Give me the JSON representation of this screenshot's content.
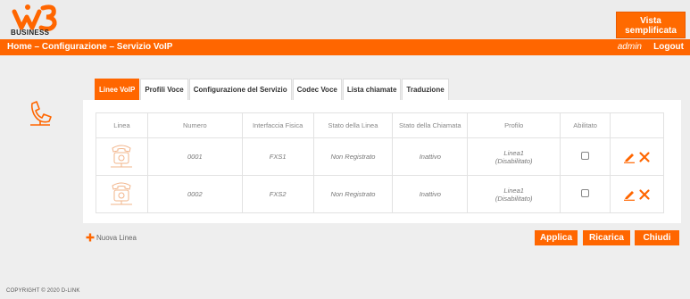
{
  "brand": {
    "logo_text": "BUSINESS",
    "accent_color": "#ff6600",
    "simple_view_label": "Vista semplificata"
  },
  "nav": {
    "breadcrumb": "Home – Configurazione – Servizio VoIP",
    "user": "admin",
    "logout_label": "Logout"
  },
  "tabs": [
    {
      "label": "Linee VoIP",
      "active": true
    },
    {
      "label": "Profili Voce",
      "active": false
    },
    {
      "label": "Configurazione del Servizio",
      "active": false
    },
    {
      "label": "Codec Voce",
      "active": false
    },
    {
      "label": "Lista chiamate",
      "active": false
    },
    {
      "label": "Traduzione",
      "active": false
    }
  ],
  "table": {
    "headers": [
      "Linea",
      "Numero",
      "Interfaccia Fisica",
      "Stato della Linea",
      "Stato della Chiamata",
      "Profilo",
      "Abilitato",
      ""
    ],
    "rows": [
      {
        "icon": "phone-icon",
        "numero": "0001",
        "interfaccia": "FXS1",
        "stato_linea": "Non Registrato",
        "stato_chiamata": "Inattivo",
        "profilo": "Linea1 (Disabilitato)",
        "abilitato": false
      },
      {
        "icon": "phone-icon",
        "numero": "0002",
        "interfaccia": "FXS2",
        "stato_linea": "Non Registrato",
        "stato_chiamata": "Inattivo",
        "profilo": "Linea1 (Disabilitato)",
        "abilitato": false
      }
    ]
  },
  "actions": {
    "add_line_label": "Nuova Linea",
    "apply_label": "Applica",
    "reload_label": "Ricarica",
    "close_label": "Chiudi"
  },
  "footer": {
    "copyright": "COPYRIGHT © 2020 D-LINK"
  }
}
